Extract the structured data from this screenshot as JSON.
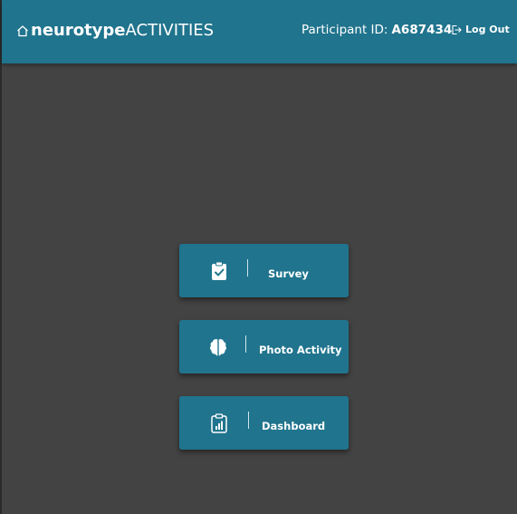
{
  "header": {
    "brand_bold": "neurotype",
    "brand_light": "ACTIVITIES",
    "participant_label": "Participant ID:",
    "participant_id": "A687434",
    "logout_label": "Log Out"
  },
  "activities": [
    {
      "label": "Survey",
      "icon": "clipboard-check-icon"
    },
    {
      "label": "Photo Activity",
      "icon": "brain-icon"
    },
    {
      "label": "Dashboard",
      "icon": "clipboard-chart-icon"
    }
  ],
  "colors": {
    "primary": "#20748d",
    "background": "#434343"
  }
}
